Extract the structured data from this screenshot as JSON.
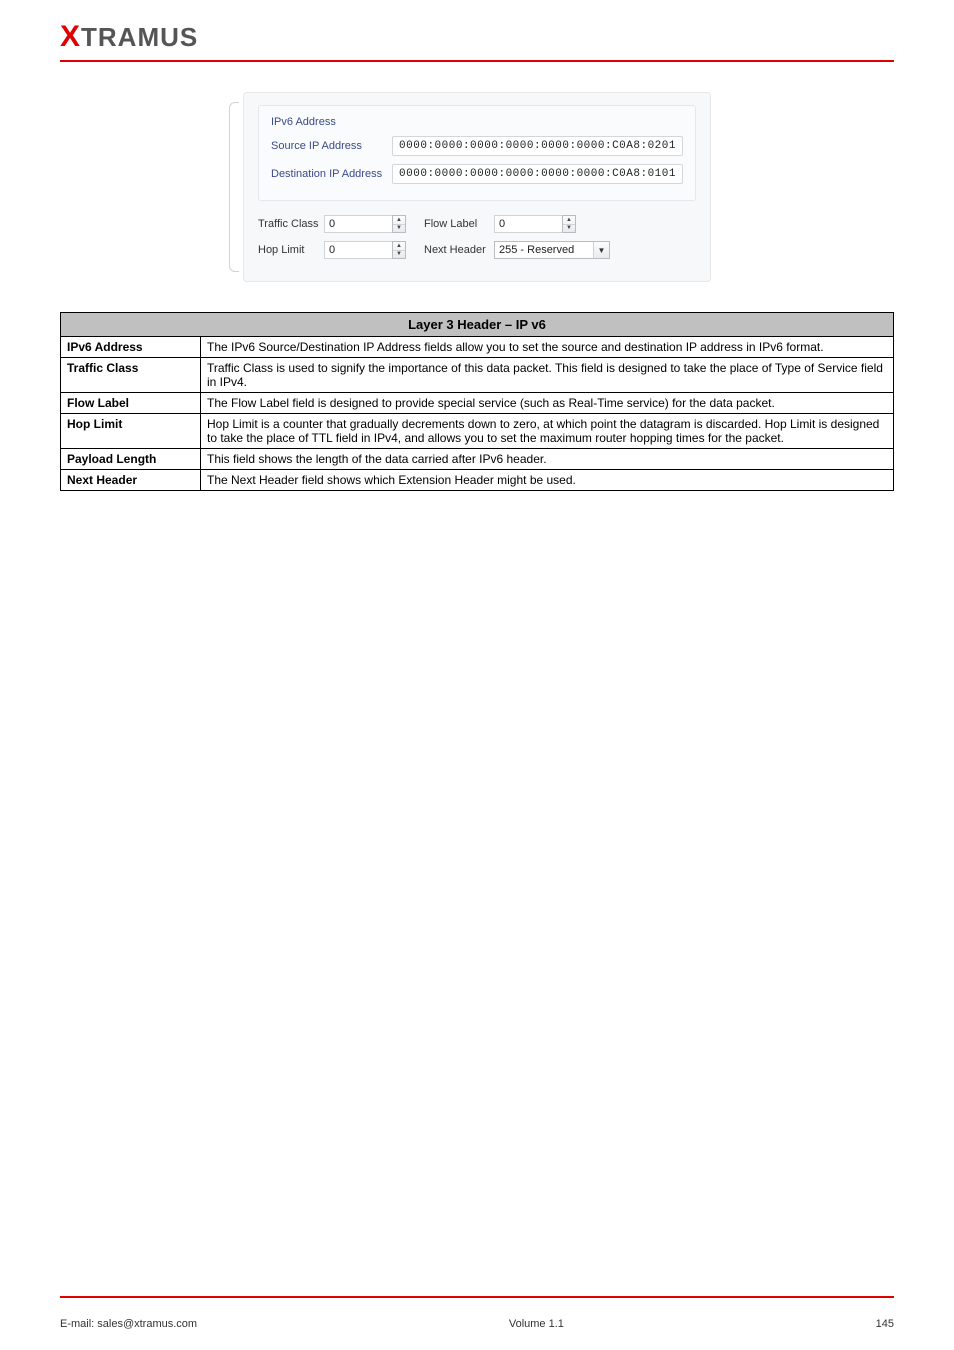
{
  "logo": {
    "x": "X",
    "rest": "TRAMUS"
  },
  "screenshot": {
    "group_title": "IPv6 Address",
    "src_label": "Source IP Address",
    "src_value": "0000:0000:0000:0000:0000:0000:C0A8:0201",
    "dst_label": "Destination IP Address",
    "dst_value": "0000:0000:0000:0000:0000:0000:C0A8:0101",
    "traffic_class_label": "Traffic Class",
    "traffic_class_value": "0",
    "flow_label_label": "Flow Label",
    "flow_label_value": "0",
    "hop_limit_label": "Hop Limit",
    "hop_limit_value": "0",
    "next_header_label": "Next Header",
    "next_header_value": "255 - Reserved"
  },
  "table": {
    "header": "Layer 3 Header – IP v6",
    "rows": [
      {
        "key": "IPv6 Address",
        "value": "The IPv6 Source/Destination IP Address fields allow you to set the source and destination IP address in IPv6 format."
      },
      {
        "key": "Traffic Class",
        "value": "Traffic Class is used to signify the importance of this data packet. This field is designed to take the place of Type of Service field in IPv4."
      },
      {
        "key": "Flow Label",
        "value": "The Flow Label field is designed to provide special service (such as Real-Time service) for the data packet."
      },
      {
        "key": "Hop Limit",
        "value": "Hop Limit is a counter that gradually decrements down to zero, at which point the datagram is discarded. Hop Limit is designed to take the place of TTL field in IPv4, and allows you to set the maximum router hopping times for the packet."
      },
      {
        "key": "Payload Length",
        "value": "This field shows the length of the data carried after IPv6 header."
      },
      {
        "key": "Next Header",
        "value": "The Next Header field shows which Extension Header might be used."
      }
    ]
  },
  "footer": {
    "left": "E-mail: sales@xtramus.com",
    "center": "Volume 1.1",
    "right": "145"
  }
}
